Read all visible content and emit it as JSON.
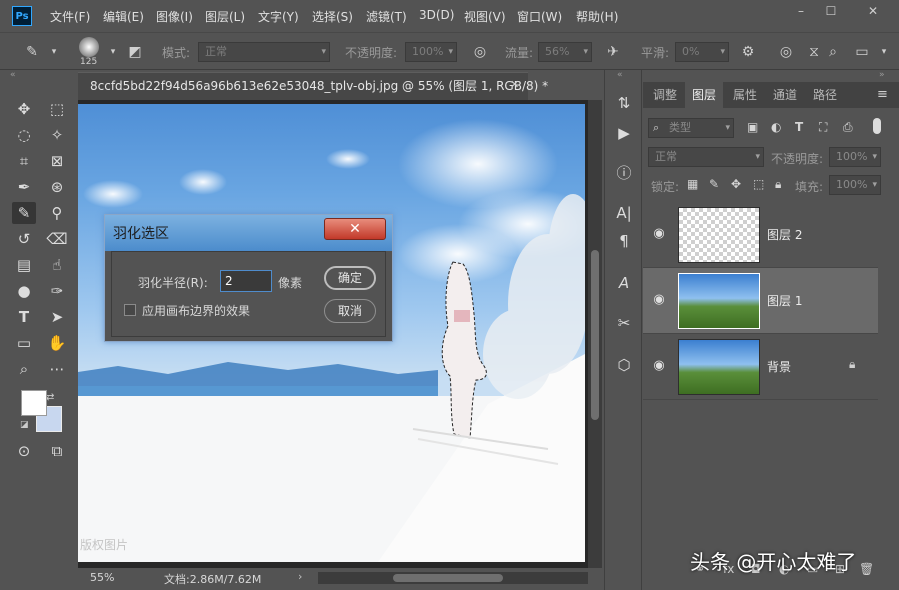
{
  "app": {
    "logo": "Ps"
  },
  "menu": [
    "文件(F)",
    "编辑(E)",
    "图像(I)",
    "图层(L)",
    "文字(Y)",
    "选择(S)",
    "滤镜(T)",
    "3D(D)",
    "视图(V)",
    "窗口(W)",
    "帮助(H)"
  ],
  "options": {
    "brush_size": "125",
    "mode_label": "模式:",
    "mode_value": "正常",
    "opacity_label": "不透明度:",
    "opacity_value": "100%",
    "flow_label": "流量:",
    "flow_value": "56%",
    "smooth_label": "平滑:",
    "smooth_value": "0%"
  },
  "document": {
    "tab_title": "8ccfd5bd22f94d56a96b613e62e53048_tplv-obj.jpg @ 55% (图层 1, RGB/8) *",
    "zoom": "55%",
    "doc_size": "文档:2.86M/7.62M"
  },
  "panel": {
    "tabs": [
      "调整",
      "图层",
      "属性",
      "通道",
      "路径"
    ],
    "active_tab": "图层",
    "filter_label": "类型",
    "blend_mode": "正常",
    "opacity_label": "不透明度:",
    "opacity_value": "100%",
    "lock_label": "锁定:",
    "fill_label": "填充:",
    "fill_value": "100%",
    "layers": [
      {
        "name": "图层 2",
        "selected": false,
        "locked": false
      },
      {
        "name": "图层 1",
        "selected": true,
        "locked": false
      },
      {
        "name": "背景",
        "selected": false,
        "locked": true
      }
    ]
  },
  "dialog": {
    "title": "羽化选区",
    "close_glyph": "✕",
    "radius_label": "羽化半径(R):",
    "radius_value": "2",
    "radius_unit": "像素",
    "checkbox_label": "应用画布边界的效果",
    "checkbox_checked": false,
    "ok_label": "确定",
    "cancel_label": "取消"
  },
  "canvas": {
    "corner_text": "版权图片"
  },
  "watermark": "头条 @开心太难了",
  "colors": {
    "accent": "#31a8ff",
    "dialog_title": "#4c8ccc",
    "close_red": "#c2392a"
  }
}
